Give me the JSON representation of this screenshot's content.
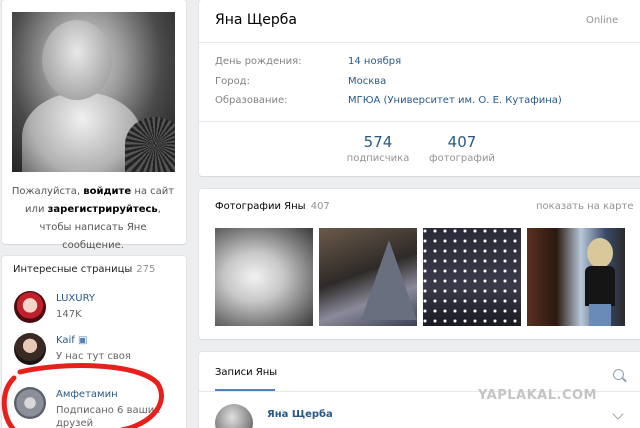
{
  "profile": {
    "name": "Яна Щерба",
    "status": "Online",
    "info": [
      {
        "label": "День рождения:",
        "value": "14 ноября"
      },
      {
        "label": "Город:",
        "value": "Москва"
      },
      {
        "label": "Образование:",
        "value": "МГЮА (Университет им. О. Е. Кутафина)"
      }
    ],
    "counters": [
      {
        "value": "574",
        "label": "подписчика"
      },
      {
        "value": "407",
        "label": "фотографий"
      }
    ]
  },
  "login_prompt": {
    "part1": "Пожалуйста, ",
    "login_link": "войдите",
    "part2": " на сайт или ",
    "register_link": "зарегистрируйтесь",
    "part3": ", чтобы написать Яне сообщение."
  },
  "pages": {
    "title": "Интересные страницы",
    "count": "275",
    "items": [
      {
        "name": "LUXURY",
        "sub": "147K"
      },
      {
        "name": "Kaif",
        "sub": "У нас тут своя"
      },
      {
        "name": "Амфетамин",
        "sub": "Подписано 6 ваших друзей"
      }
    ]
  },
  "photos": {
    "title": "Фотографии Яны",
    "count": "407",
    "map_link": "показать на карте"
  },
  "wall": {
    "tab": "Записи Яны",
    "post_author": "Яна Щерба"
  },
  "watermark": "YAPLAKAL.COM",
  "colors": {
    "link": "#2a5885",
    "accent": "#5181b8",
    "background": "#edeef0",
    "annotation": "#e8201c"
  }
}
